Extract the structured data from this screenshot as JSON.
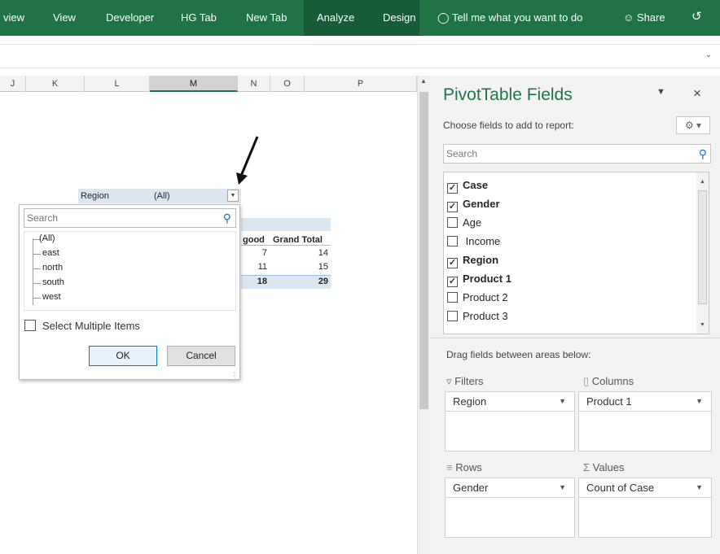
{
  "ribbon": {
    "tabs": [
      {
        "label": "view"
      },
      {
        "label": "View"
      },
      {
        "label": "Developer"
      },
      {
        "label": "HG Tab"
      },
      {
        "label": "New Tab"
      },
      {
        "label": "Analyze"
      },
      {
        "label": "Design"
      }
    ],
    "tell_me": "Tell me what you want to do",
    "share": "Share",
    "colors": {
      "ribbon": "#217346",
      "active": "#185c37"
    }
  },
  "grid": {
    "columns": [
      "J",
      "K",
      "L",
      "M",
      "N",
      "O",
      "P"
    ],
    "selected_column": "M"
  },
  "pivot": {
    "filter_field": "Region",
    "filter_value": "(All)",
    "header_good": "good",
    "header_grand_total": "Grand Total",
    "rows": [
      {
        "good": "7",
        "total": "14"
      },
      {
        "good": "11",
        "total": "15"
      },
      {
        "good": "18",
        "total": "29"
      }
    ]
  },
  "filter_popup": {
    "search_placeholder": "Search",
    "items": [
      "(All)",
      "east",
      "north",
      "south",
      "west"
    ],
    "select_multiple": "Select Multiple Items",
    "ok": "OK",
    "cancel": "Cancel"
  },
  "pane": {
    "title": "PivotTable Fields",
    "subtitle": "Choose fields to add to report:",
    "search_placeholder": "Search",
    "fields": [
      {
        "name": "Case",
        "checked": true
      },
      {
        "name": "Gender",
        "checked": true
      },
      {
        "name": "Age",
        "checked": false
      },
      {
        "name": "Income",
        "checked": false
      },
      {
        "name": "Region",
        "checked": true
      },
      {
        "name": "Product 1",
        "checked": true
      },
      {
        "name": "Product 2",
        "checked": false
      },
      {
        "name": "Product 3",
        "checked": false
      }
    ],
    "drag_hint": "Drag fields between areas below:",
    "areas": {
      "filters": {
        "label": "Filters",
        "item": "Region"
      },
      "columns": {
        "label": "Columns",
        "item": "Product 1"
      },
      "rows": {
        "label": "Rows",
        "item": "Gender"
      },
      "values": {
        "label": "Values",
        "item": "Count of Case"
      }
    }
  }
}
